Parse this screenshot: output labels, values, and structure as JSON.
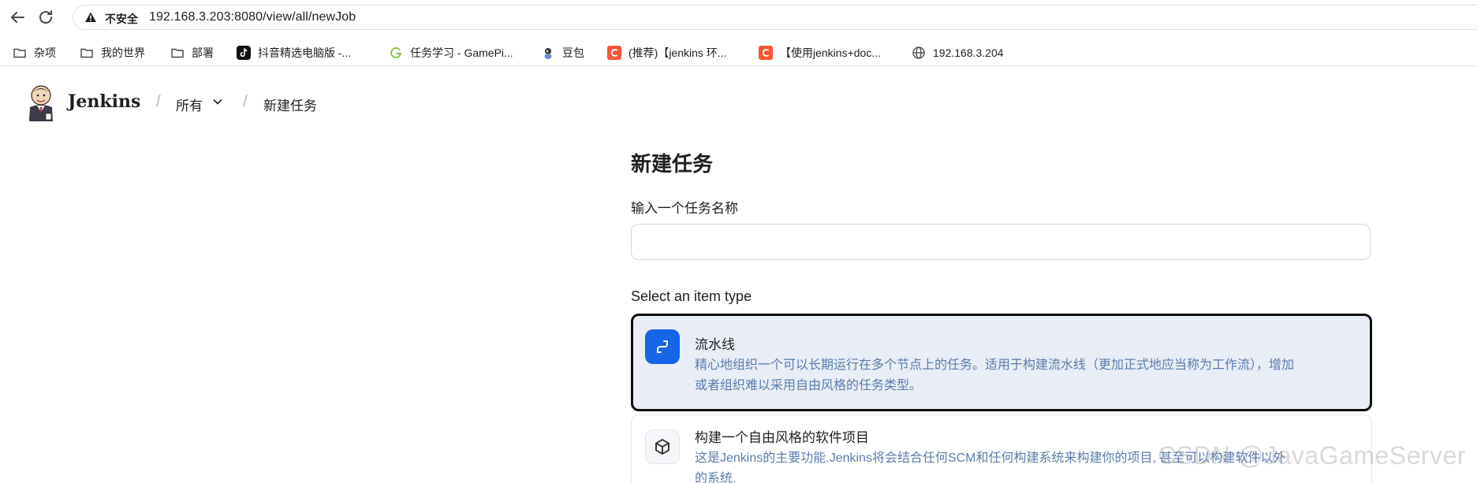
{
  "browser": {
    "security_label": "不安全",
    "url": "192.168.3.203:8080/view/all/newJob"
  },
  "bookmarks": [
    {
      "label": "杂项",
      "icon": "folder-icon"
    },
    {
      "label": "我的世界",
      "icon": "folder-icon"
    },
    {
      "label": "部署",
      "icon": "folder-icon"
    },
    {
      "label": "抖音精选电脑版 -...",
      "icon": "tiktok-icon"
    },
    {
      "label": "任务学习 - GamePi...",
      "icon": "g-logo-icon"
    },
    {
      "label": "豆包",
      "icon": "doubao-icon"
    },
    {
      "label": "(推荐)【jenkins 环...",
      "icon": "csdn-icon"
    },
    {
      "label": "【使用jenkins+doc...",
      "icon": "csdn-icon"
    },
    {
      "label": "192.168.3.204",
      "icon": "globe-icon"
    }
  ],
  "jenkins": {
    "brand": "Jenkins",
    "breadcrumb": [
      "所有",
      "新建任务"
    ]
  },
  "page": {
    "title": "新建任务",
    "name_label": "输入一个任务名称",
    "name_value": "",
    "type_label": "Select an item type",
    "items": [
      {
        "title": "流水线",
        "description": "精心地组织一个可以长期运行在多个节点上的任务。适用于构建流水线（更加正式地应当称为工作流），增加或者组织难以采用自由风格的任务类型。",
        "icon": "pipeline-icon",
        "selected": true
      },
      {
        "title": "构建一个自由风格的软件项目",
        "description": "这是Jenkins的主要功能.Jenkins将会结合任何SCM和任何构建系统来构建你的项目, 甚至可以构建软件以外的系统.",
        "icon": "freestyle-cube-icon",
        "selected": false
      }
    ]
  },
  "watermark": "CSDN @JavaGameServer",
  "colors": {
    "accent": "#1565e6",
    "selected_bg": "#e9edf5",
    "desc_text": "#5b7cae"
  }
}
